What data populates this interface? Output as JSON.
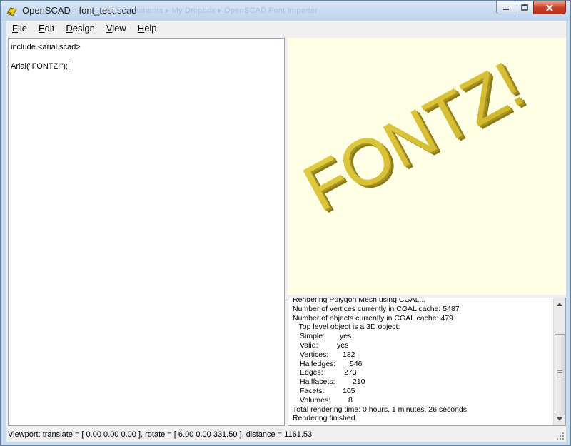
{
  "window": {
    "title": "OpenSCAD - font_test.scad",
    "background_title_ghost": "Documents  ▸  My Dropbox  ▸  OpenSCAD Font Importer",
    "accent_color": "#c9dcef",
    "close_color": "#c7402a"
  },
  "menu": {
    "items": [
      {
        "label": "File",
        "mnemonic": "F",
        "rest": "ile"
      },
      {
        "label": "Edit",
        "mnemonic": "E",
        "rest": "dit"
      },
      {
        "label": "Design",
        "mnemonic": "D",
        "rest": "esign"
      },
      {
        "label": "View",
        "mnemonic": "V",
        "rest": "iew"
      },
      {
        "label": "Help",
        "mnemonic": "H",
        "rest": "elp"
      }
    ]
  },
  "editor": {
    "lines": [
      "include <arial.scad>",
      "",
      "Arial(\"FONTZ!\");"
    ]
  },
  "viewport": {
    "rendered_text": "FONTZ!",
    "model_color": "#d8c23a",
    "background_color": "#ffffe5"
  },
  "console": {
    "lines": [
      "Rendering Polygon Mesh using CGAL...",
      "Number of vertices currently in CGAL cache: 5487",
      "Number of objects currently in CGAL cache: 479",
      "   Top level object is a 3D object:"
    ],
    "stats": [
      {
        "key": "Simple:",
        "value": "yes"
      },
      {
        "key": "Valid:",
        "value": "yes"
      },
      {
        "key": "Vertices:",
        "value": "182"
      },
      {
        "key": "Halfedges:",
        "value": "546"
      },
      {
        "key": "Edges:",
        "value": "273"
      },
      {
        "key": "Halffacets:",
        "value": "210"
      },
      {
        "key": "Facets:",
        "value": "105"
      },
      {
        "key": "Volumes:",
        "value": "8"
      }
    ],
    "footer_lines": [
      "Total rendering time: 0 hours, 1 minutes, 26 seconds",
      "Rendering finished."
    ]
  },
  "statusbar": {
    "text": "Viewport: translate = [ 0.00 0.00 0.00 ], rotate = [ 6.00 0.00 331.50 ], distance = 1161.53"
  }
}
